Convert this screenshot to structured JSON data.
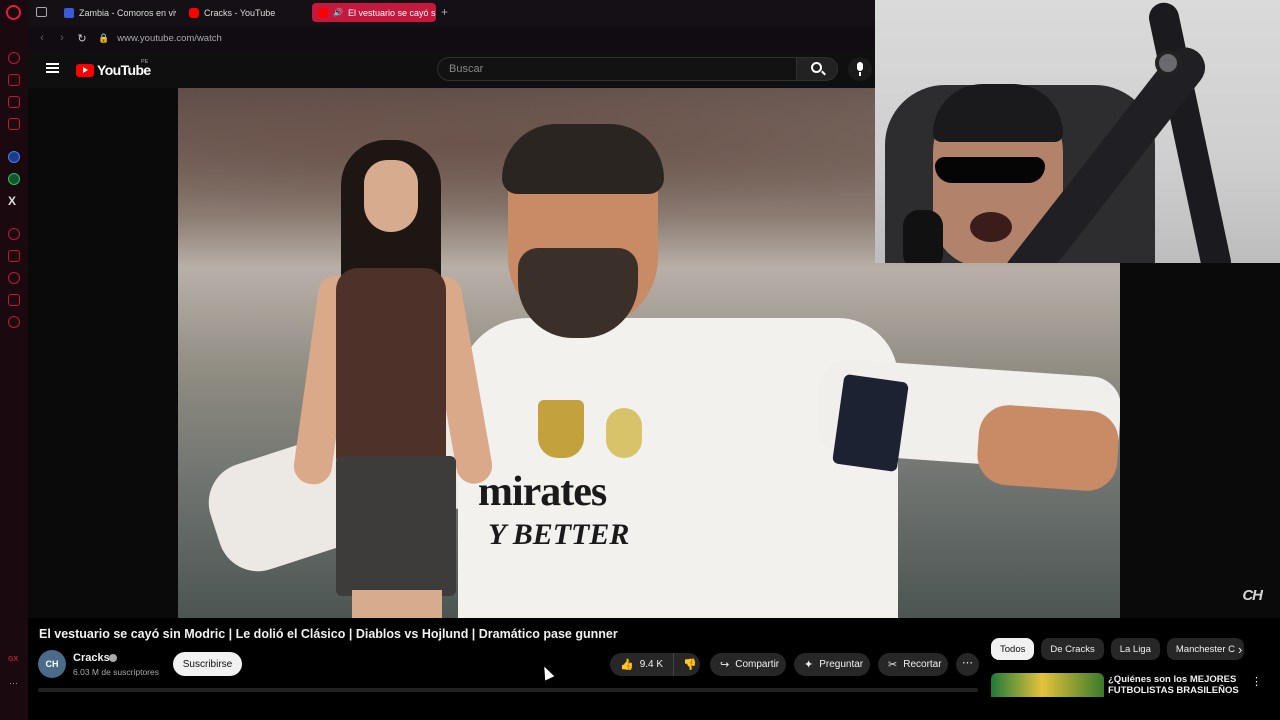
{
  "browser": {
    "tabs": [
      {
        "label": "Zambia - Comoros en vivo"
      },
      {
        "label": "Cracks - YouTube"
      },
      {
        "label": "El vestuario se cayó sin"
      }
    ],
    "url": "www.youtube.com/watch"
  },
  "youtube": {
    "logo_text": "YouTube",
    "region": "PE",
    "search_placeholder": "Buscar"
  },
  "video": {
    "watermark": "CH",
    "title": "El vestuario se cayó sin Modric | Le dolió el Clásico | Diablos vs Hojlund | Dramático pase gunner",
    "scene_text_1": "mirates",
    "scene_text_2": "Y BETTER"
  },
  "channel": {
    "avatar_text": "CH",
    "name": "Cracks",
    "subscribers": "6.03 M de suscriptores",
    "subscribe_label": "Suscribirse"
  },
  "actions": {
    "likes": "9.4 K",
    "share": "Compartir",
    "ask": "Preguntar",
    "clip": "Recortar"
  },
  "chips": [
    "Todos",
    "De Cracks",
    "La Liga",
    "Manchester C"
  ],
  "recommendation": {
    "title": "¿Quiénes son los MEJORES FUTBOLISTAS BRASILEÑOS d"
  },
  "sidebar_labels": {
    "x": "X",
    "gx": "GX"
  },
  "colors": {
    "opera_red": "#c6183d",
    "youtube_red": "#ff0000",
    "bg": "#0f0f0f"
  }
}
